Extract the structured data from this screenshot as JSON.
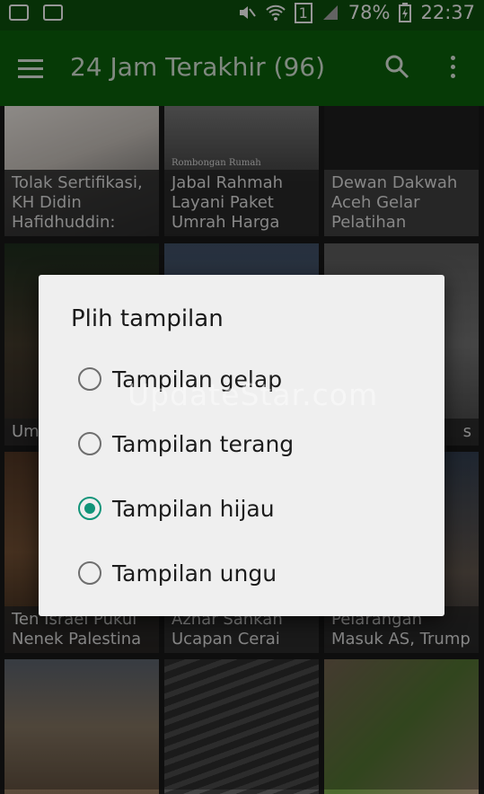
{
  "status_bar": {
    "battery": "78%",
    "time": "22:37",
    "sim": "1"
  },
  "app_bar": {
    "title": "24 Jam Terakhir (96)"
  },
  "grid": {
    "tiles": [
      {
        "caption": "Tolak Sertifikasi, KH Didin Hafidhuddin:"
      },
      {
        "caption": "Jabal Rahmah Layani Paket Umrah Harga",
        "image_text": "Rombongan Rumah"
      },
      {
        "caption": "Dewan Dakwah Aceh Gelar Pelatihan"
      },
      {
        "caption": "Um Mal"
      },
      {
        "caption": ""
      },
      {
        "caption": "s"
      },
      {
        "caption": "Ten Israel Pukul Nenek Palestina"
      },
      {
        "caption": "Azhar Sankan Ucapan Cerai"
      },
      {
        "caption": "Pelarangan Masuk AS, Trump"
      }
    ]
  },
  "dialog": {
    "title": "Plih tampilan",
    "options": [
      {
        "label": "Tampilan gelap",
        "selected": false
      },
      {
        "label": "Tampilan terang",
        "selected": false
      },
      {
        "label": "Tampilan hijau",
        "selected": true
      },
      {
        "label": "Tampilan ungu",
        "selected": false
      }
    ]
  },
  "watermark": "UpdateStar.com",
  "colors": {
    "status_bar": "#0b4a0b",
    "app_bar": "#0a5a0a",
    "radio_selected": "#119479",
    "dialog_bg": "#efefef"
  }
}
